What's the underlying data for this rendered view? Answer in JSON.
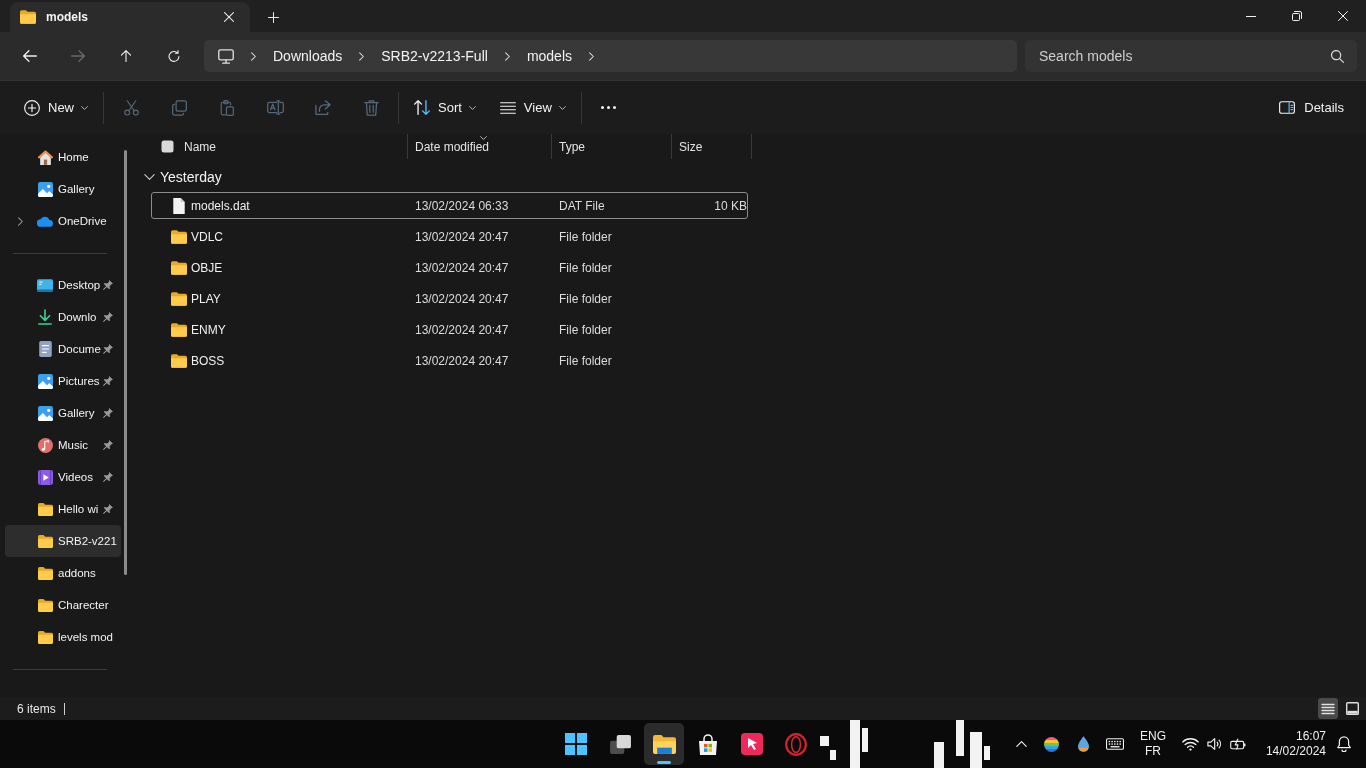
{
  "window": {
    "tab_title": "models"
  },
  "nav_buttons": [
    {
      "kind": "back",
      "disabled": false
    },
    {
      "kind": "forward",
      "disabled": true
    },
    {
      "kind": "up",
      "disabled": false
    },
    {
      "kind": "refresh",
      "disabled": false
    }
  ],
  "breadcrumb": [
    "Downloads",
    "SRB2-v2213-Full",
    "models"
  ],
  "search": {
    "placeholder": "Search models"
  },
  "toolbar": {
    "groups": [
      [
        {
          "kind": "new",
          "label": "New",
          "disabled": false
        }
      ],
      [
        {
          "kind": "cut",
          "disabled": true
        },
        {
          "kind": "copy",
          "disabled": true
        },
        {
          "kind": "paste",
          "disabled": true
        },
        {
          "kind": "rename",
          "disabled": true
        },
        {
          "kind": "share",
          "disabled": true
        },
        {
          "kind": "delete",
          "disabled": true
        }
      ],
      [
        {
          "kind": "sort",
          "label": "Sort",
          "disabled": false
        },
        {
          "kind": "view",
          "label": "View",
          "disabled": false
        }
      ],
      [
        {
          "kind": "more",
          "disabled": false
        }
      ]
    ],
    "details": {
      "label": "Details"
    }
  },
  "sidebar": {
    "sections": [
      [
        {
          "kind": "home",
          "label": "Home",
          "expandable": false,
          "pinned": false,
          "selected": false
        },
        {
          "kind": "gallery",
          "label": "Gallery",
          "expandable": false,
          "pinned": false,
          "selected": false
        },
        {
          "kind": "cloud",
          "label": "OneDrive",
          "expandable": true,
          "pinned": false,
          "selected": false
        }
      ],
      [
        {
          "kind": "desktop",
          "label": "Desktop",
          "expandable": false,
          "pinned": true,
          "selected": false
        },
        {
          "kind": "downloads",
          "label": "Downlo",
          "expandable": false,
          "pinned": true,
          "selected": false
        },
        {
          "kind": "documents",
          "label": "Docume",
          "expandable": false,
          "pinned": true,
          "selected": false
        },
        {
          "kind": "pictures",
          "label": "Pictures",
          "expandable": false,
          "pinned": true,
          "selected": false
        },
        {
          "kind": "gallery",
          "label": "Gallery",
          "expandable": false,
          "pinned": true,
          "selected": false
        },
        {
          "kind": "music",
          "label": "Music",
          "expandable": false,
          "pinned": true,
          "selected": false
        },
        {
          "kind": "videos",
          "label": "Videos",
          "expandable": false,
          "pinned": true,
          "selected": false
        },
        {
          "kind": "folder",
          "label": "Hello wi",
          "expandable": false,
          "pinned": true,
          "selected": false
        },
        {
          "kind": "folder",
          "label": "SRB2-v221",
          "expandable": false,
          "pinned": false,
          "selected": true
        },
        {
          "kind": "folder",
          "label": "addons",
          "expandable": false,
          "pinned": false,
          "selected": false
        },
        {
          "kind": "folder",
          "label": "Charecter",
          "expandable": false,
          "pinned": false,
          "selected": false
        },
        {
          "kind": "folder",
          "label": "levels mod",
          "expandable": false,
          "pinned": false,
          "selected": false
        }
      ]
    ]
  },
  "table": {
    "select_all": {
      "checked": false
    },
    "columns": [
      {
        "label": "Name",
        "sorted": false
      },
      {
        "label": "Date modified",
        "sorted": true
      },
      {
        "label": "Type",
        "sorted": false
      },
      {
        "label": "Size",
        "sorted": false
      }
    ],
    "groups": [
      {
        "label": "Yesterday",
        "expanded": true,
        "rows": [
          {
            "kind": "file",
            "name": "models.dat",
            "date_modified": "13/02/2024 06:33",
            "type": "DAT File",
            "size": "10 KB",
            "focused": true
          },
          {
            "kind": "folder",
            "name": "VDLC",
            "date_modified": "13/02/2024 20:47",
            "type": "File folder",
            "focused": false
          },
          {
            "kind": "folder",
            "name": "OBJE",
            "date_modified": "13/02/2024 20:47",
            "type": "File folder",
            "focused": false
          },
          {
            "kind": "folder",
            "name": "PLAY",
            "date_modified": "13/02/2024 20:47",
            "type": "File folder",
            "focused": false
          },
          {
            "kind": "folder",
            "name": "ENMY",
            "date_modified": "13/02/2024 20:47",
            "type": "File folder",
            "focused": false
          },
          {
            "kind": "folder",
            "name": "BOSS",
            "date_modified": "13/02/2024 20:47",
            "type": "File folder",
            "focused": false
          }
        ]
      }
    ]
  },
  "status_bar": {
    "item_count": "6 items",
    "views": [
      {
        "kind": "details",
        "selected": true
      },
      {
        "kind": "tiles",
        "selected": false
      }
    ]
  },
  "taskbar": {
    "apps": [
      {
        "kind": "start",
        "active": false
      },
      {
        "kind": "task-view",
        "active": false
      },
      {
        "kind": "explorer",
        "active": true
      },
      {
        "kind": "store",
        "active": false
      },
      {
        "kind": "pointer",
        "active": false
      },
      {
        "kind": "browser",
        "active": false
      }
    ],
    "language": [
      "ENG",
      "FR"
    ],
    "time": "16:07",
    "date": "14/02/2024"
  }
}
